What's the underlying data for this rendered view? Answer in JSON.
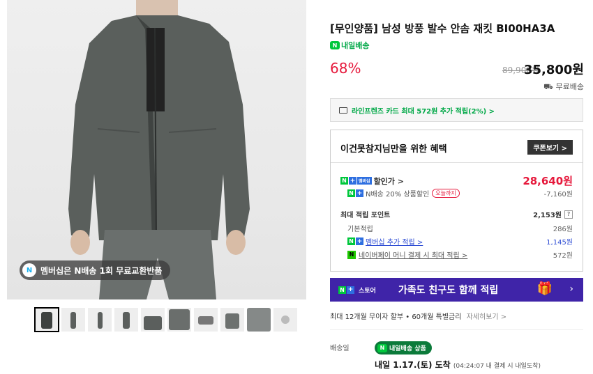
{
  "product": {
    "title": "[무인양품] 남성 방풍 발수 안솜 재킷 BI00HA3A",
    "tomorrow_delivery": "내일배송",
    "discount_rate": "68%",
    "original_price": "89,900원",
    "sale_price": "35,800원",
    "shipping": "무료배송"
  },
  "gallery": {
    "badge_text": "멤버십은 N배송 1회 무료교환반품",
    "thumbnail_count": 10,
    "selected_index": 0
  },
  "card_promo": "라인프렌즈 카드 최대 572원 추가 적립(2%) >",
  "benefit": {
    "title": "이건못참지님만을 위한 혜택",
    "coupon_button": "쿠폰보기 >",
    "member_price_label": "할인가 >",
    "member_price_value": "28,640원",
    "n_discount_label": "N배송 20% 상품할인",
    "today_tag": "오늘까지",
    "n_discount_value": "-7,160원",
    "points_label": "최대 적립 포인트",
    "points_value": "2,153원",
    "basic_label": "기본적립",
    "basic_value": "286원",
    "membership_label": "멤버십 추가 적립 >",
    "membership_value": "1,145원",
    "npay_label": "네이버페이 머니 결제 시 최대 적립 >",
    "npay_value": "572원"
  },
  "banner": {
    "store": "스토어",
    "text": "가족도 친구도 함께 적립",
    "arrow": "›"
  },
  "installment": {
    "text": "최대 12개월 무이자 할부 • 60개월 특별금리",
    "more": "자세히보기 >"
  },
  "delivery": {
    "label": "배송일",
    "pill": "내일배송 상품",
    "arrival": "내일 1.17.(토) 도착",
    "note": "(04:24:07 내 결제 시 내일도착)"
  },
  "colors": {
    "accent_red": "#e6193c",
    "naver_green": "#00c73c",
    "banner_purple": "#3f24a8",
    "link_blue": "#2e4dd4"
  }
}
